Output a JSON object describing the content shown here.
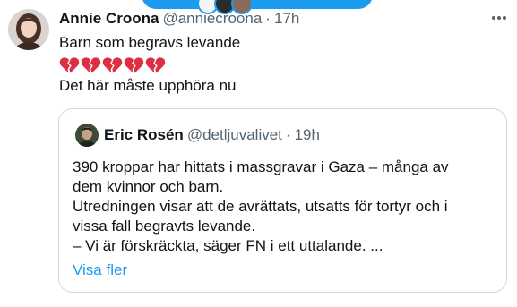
{
  "post": {
    "author_name": "Annie Croona",
    "handle": "@anniecroona",
    "separator": "·",
    "time": "17h",
    "text_line1": "Barn som begravs levande",
    "text_line3": "Det här måste upphöra nu",
    "emoji_icon": "broken-heart-icon",
    "emoji_count": 5
  },
  "quote": {
    "author_name": "Eric Rosén",
    "handle": "@detljuvalivet",
    "separator": "·",
    "time": "19h",
    "lines": [
      "390 kroppar har hittats i massgravar i Gaza – många av",
      "dem kvinnor och barn.",
      "Utredningen visar att de avrättats, utsatts för tortyr och i",
      "vissa fall begravts levande.",
      "– Vi är förskräckta, säger FN i ett uttalande. ..."
    ],
    "show_more": "Visa fler"
  },
  "colors": {
    "accent": "#1d9bf0",
    "text": "#0f1419",
    "secondary": "#536471",
    "border": "#cfd9de",
    "heart": "#dd2e44"
  }
}
